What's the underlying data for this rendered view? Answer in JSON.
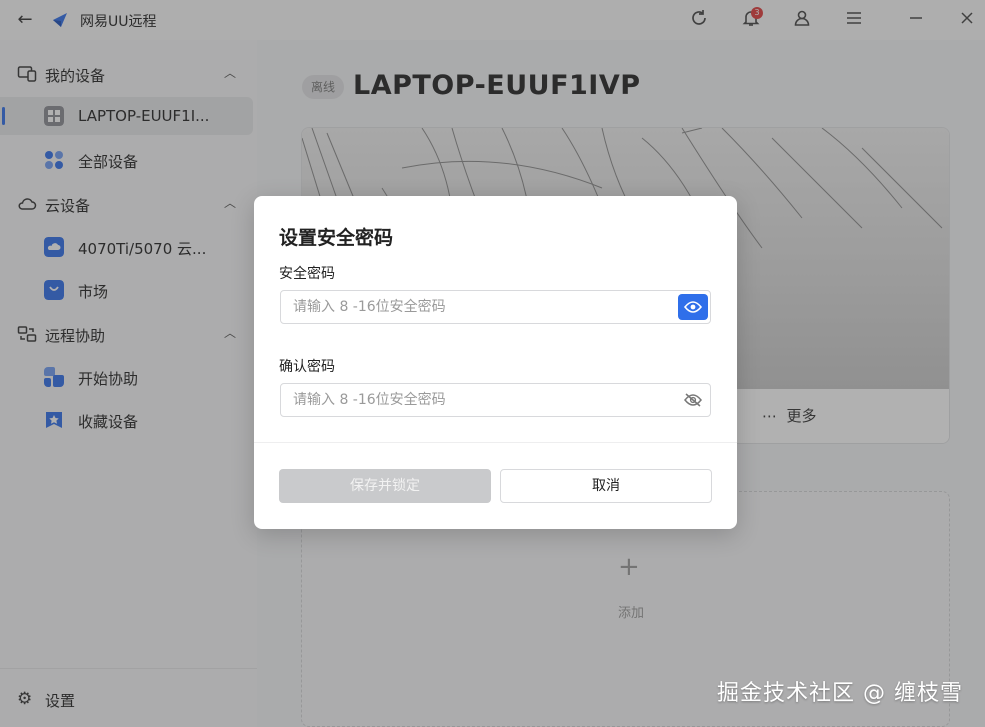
{
  "app": {
    "title": "网易UU远程",
    "notification_count": "3"
  },
  "sidebar": {
    "groups": [
      {
        "label": "我的设备",
        "items": [
          {
            "label": "LAPTOP-EUUF1I...",
            "icon": "windows-device-icon",
            "active": true
          },
          {
            "label": "全部设备",
            "icon": "all-devices-icon",
            "active": false
          }
        ]
      },
      {
        "label": "云设备",
        "items": [
          {
            "label": "4070Ti/5070 云...",
            "icon": "cloud-pc-icon",
            "active": false
          },
          {
            "label": "市场",
            "icon": "shopping-bag-icon",
            "active": false
          }
        ]
      },
      {
        "label": "远程协助",
        "items": [
          {
            "label": "开始协助",
            "icon": "start-assist-icon",
            "active": false
          },
          {
            "label": "收藏设备",
            "icon": "favorite-star-icon",
            "active": false
          }
        ]
      }
    ],
    "settings_label": "设置"
  },
  "main": {
    "status": "离线",
    "device_name": "LAPTOP-EUUF1IVP",
    "more_label": "更多",
    "add_label": "添加"
  },
  "modal": {
    "title": "设置安全密码",
    "password_label": "安全密码",
    "password_placeholder": "请输入 8 -16位安全密码",
    "confirm_label": "确认密码",
    "confirm_placeholder": "请输入 8 -16位安全密码",
    "save_label": "保存并锁定",
    "cancel_label": "取消"
  },
  "watermark": "掘金技术社区 @ 缠枝雪",
  "colors": {
    "accent": "#2f6fea",
    "badge": "#e23b3b"
  }
}
